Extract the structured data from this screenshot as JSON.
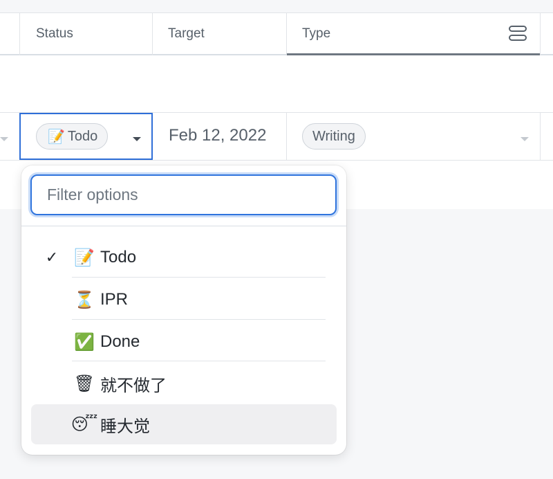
{
  "header": {
    "columns": [
      {
        "label": "Status"
      },
      {
        "label": "Target"
      },
      {
        "label": "Type"
      }
    ]
  },
  "row": {
    "status": {
      "emoji": "📝",
      "label": "Todo"
    },
    "target": "Feb 12, 2022",
    "type": "Writing"
  },
  "dropdown": {
    "filter_placeholder": "Filter options",
    "filter_value": "",
    "options": [
      {
        "emoji": "📝",
        "label": "Todo",
        "selected_mark": "✓"
      },
      {
        "emoji": "⏳",
        "label": "IPR",
        "selected_mark": ""
      },
      {
        "emoji": "✅",
        "label": "Done",
        "selected_mark": ""
      },
      {
        "emoji": "🗑",
        "label": "就不做了",
        "selected_mark": ""
      },
      {
        "emoji": "😴",
        "label": "睡大觉",
        "selected_mark": ""
      }
    ]
  },
  "colors": {
    "accent": "#2f6fd8",
    "highlight": "#efeff1"
  },
  "icons": {
    "layout": "layout-rows-icon",
    "caret": "chevron-down-icon",
    "check": "check-icon"
  }
}
